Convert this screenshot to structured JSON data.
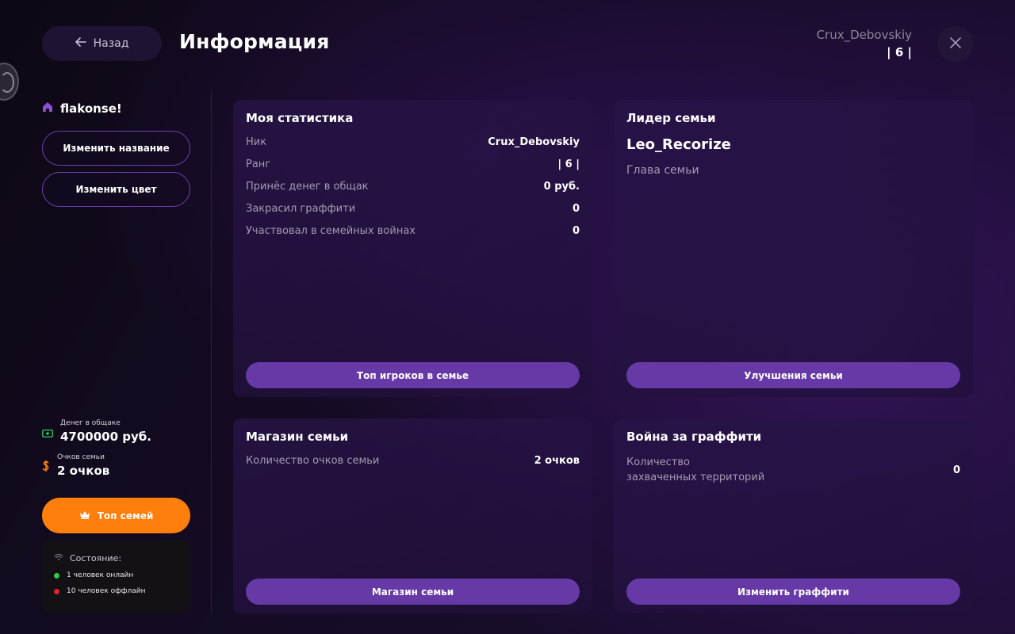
{
  "header": {
    "back_label": "Назад",
    "title": "Информация",
    "username": "Crux_Debovskiy",
    "rank": "| 6 |"
  },
  "sidebar": {
    "family_name": "flakonse!",
    "rename_label": "Изменить название",
    "recolor_label": "Изменить цвет",
    "money_label": "Денег в общаке",
    "money_value": "4700000 руб.",
    "points_label": "Очков семьи",
    "points_value": "2 очков",
    "top_families_label": "Топ семей",
    "status": {
      "title": "Состояние:",
      "online": "1 человек онлайн",
      "offline": "10 человек оффлайн"
    }
  },
  "cards": {
    "my_stats": {
      "title": "Моя статистика",
      "rows": [
        {
          "key": "Ник",
          "value": "Crux_Debovskiy"
        },
        {
          "key": "Ранг",
          "value": "| 6 |"
        },
        {
          "key": "Принёс денег в общак",
          "value": "0 руб."
        },
        {
          "key": "Закрасил граффити",
          "value": "0"
        },
        {
          "key": "Участвовал в семейных войнах",
          "value": "0"
        }
      ],
      "button": "Топ игроков в семье"
    },
    "leader": {
      "title": "Лидер семьи",
      "name": "Leo_Recorize",
      "role": "Глава семьи",
      "button": "Улучшения семьи"
    },
    "shop": {
      "title": "Магазин семьи",
      "row_key": "Количество очков семьи",
      "row_value": "2 очков",
      "button": "Магазин семьи"
    },
    "graffiti": {
      "title": "Война за граффити",
      "row_key_line1": "Количество",
      "row_key_line2": "захваченных территорий",
      "row_value": "0",
      "button": "Изменить граффити"
    }
  },
  "icons": {
    "back": "arrow-left-icon",
    "close": "close-icon",
    "home": "home-icon",
    "money": "cash-icon",
    "points": "currency-icon",
    "crown": "crown-icon",
    "wifi": "wifi-icon"
  },
  "colors": {
    "accent_purple": "#6639a6",
    "accent_orange": "#fe7f0b",
    "online": "#2ecc40",
    "offline": "#e02424",
    "home_icon": "#8a4fd6",
    "money_icon": "#27c35a"
  }
}
